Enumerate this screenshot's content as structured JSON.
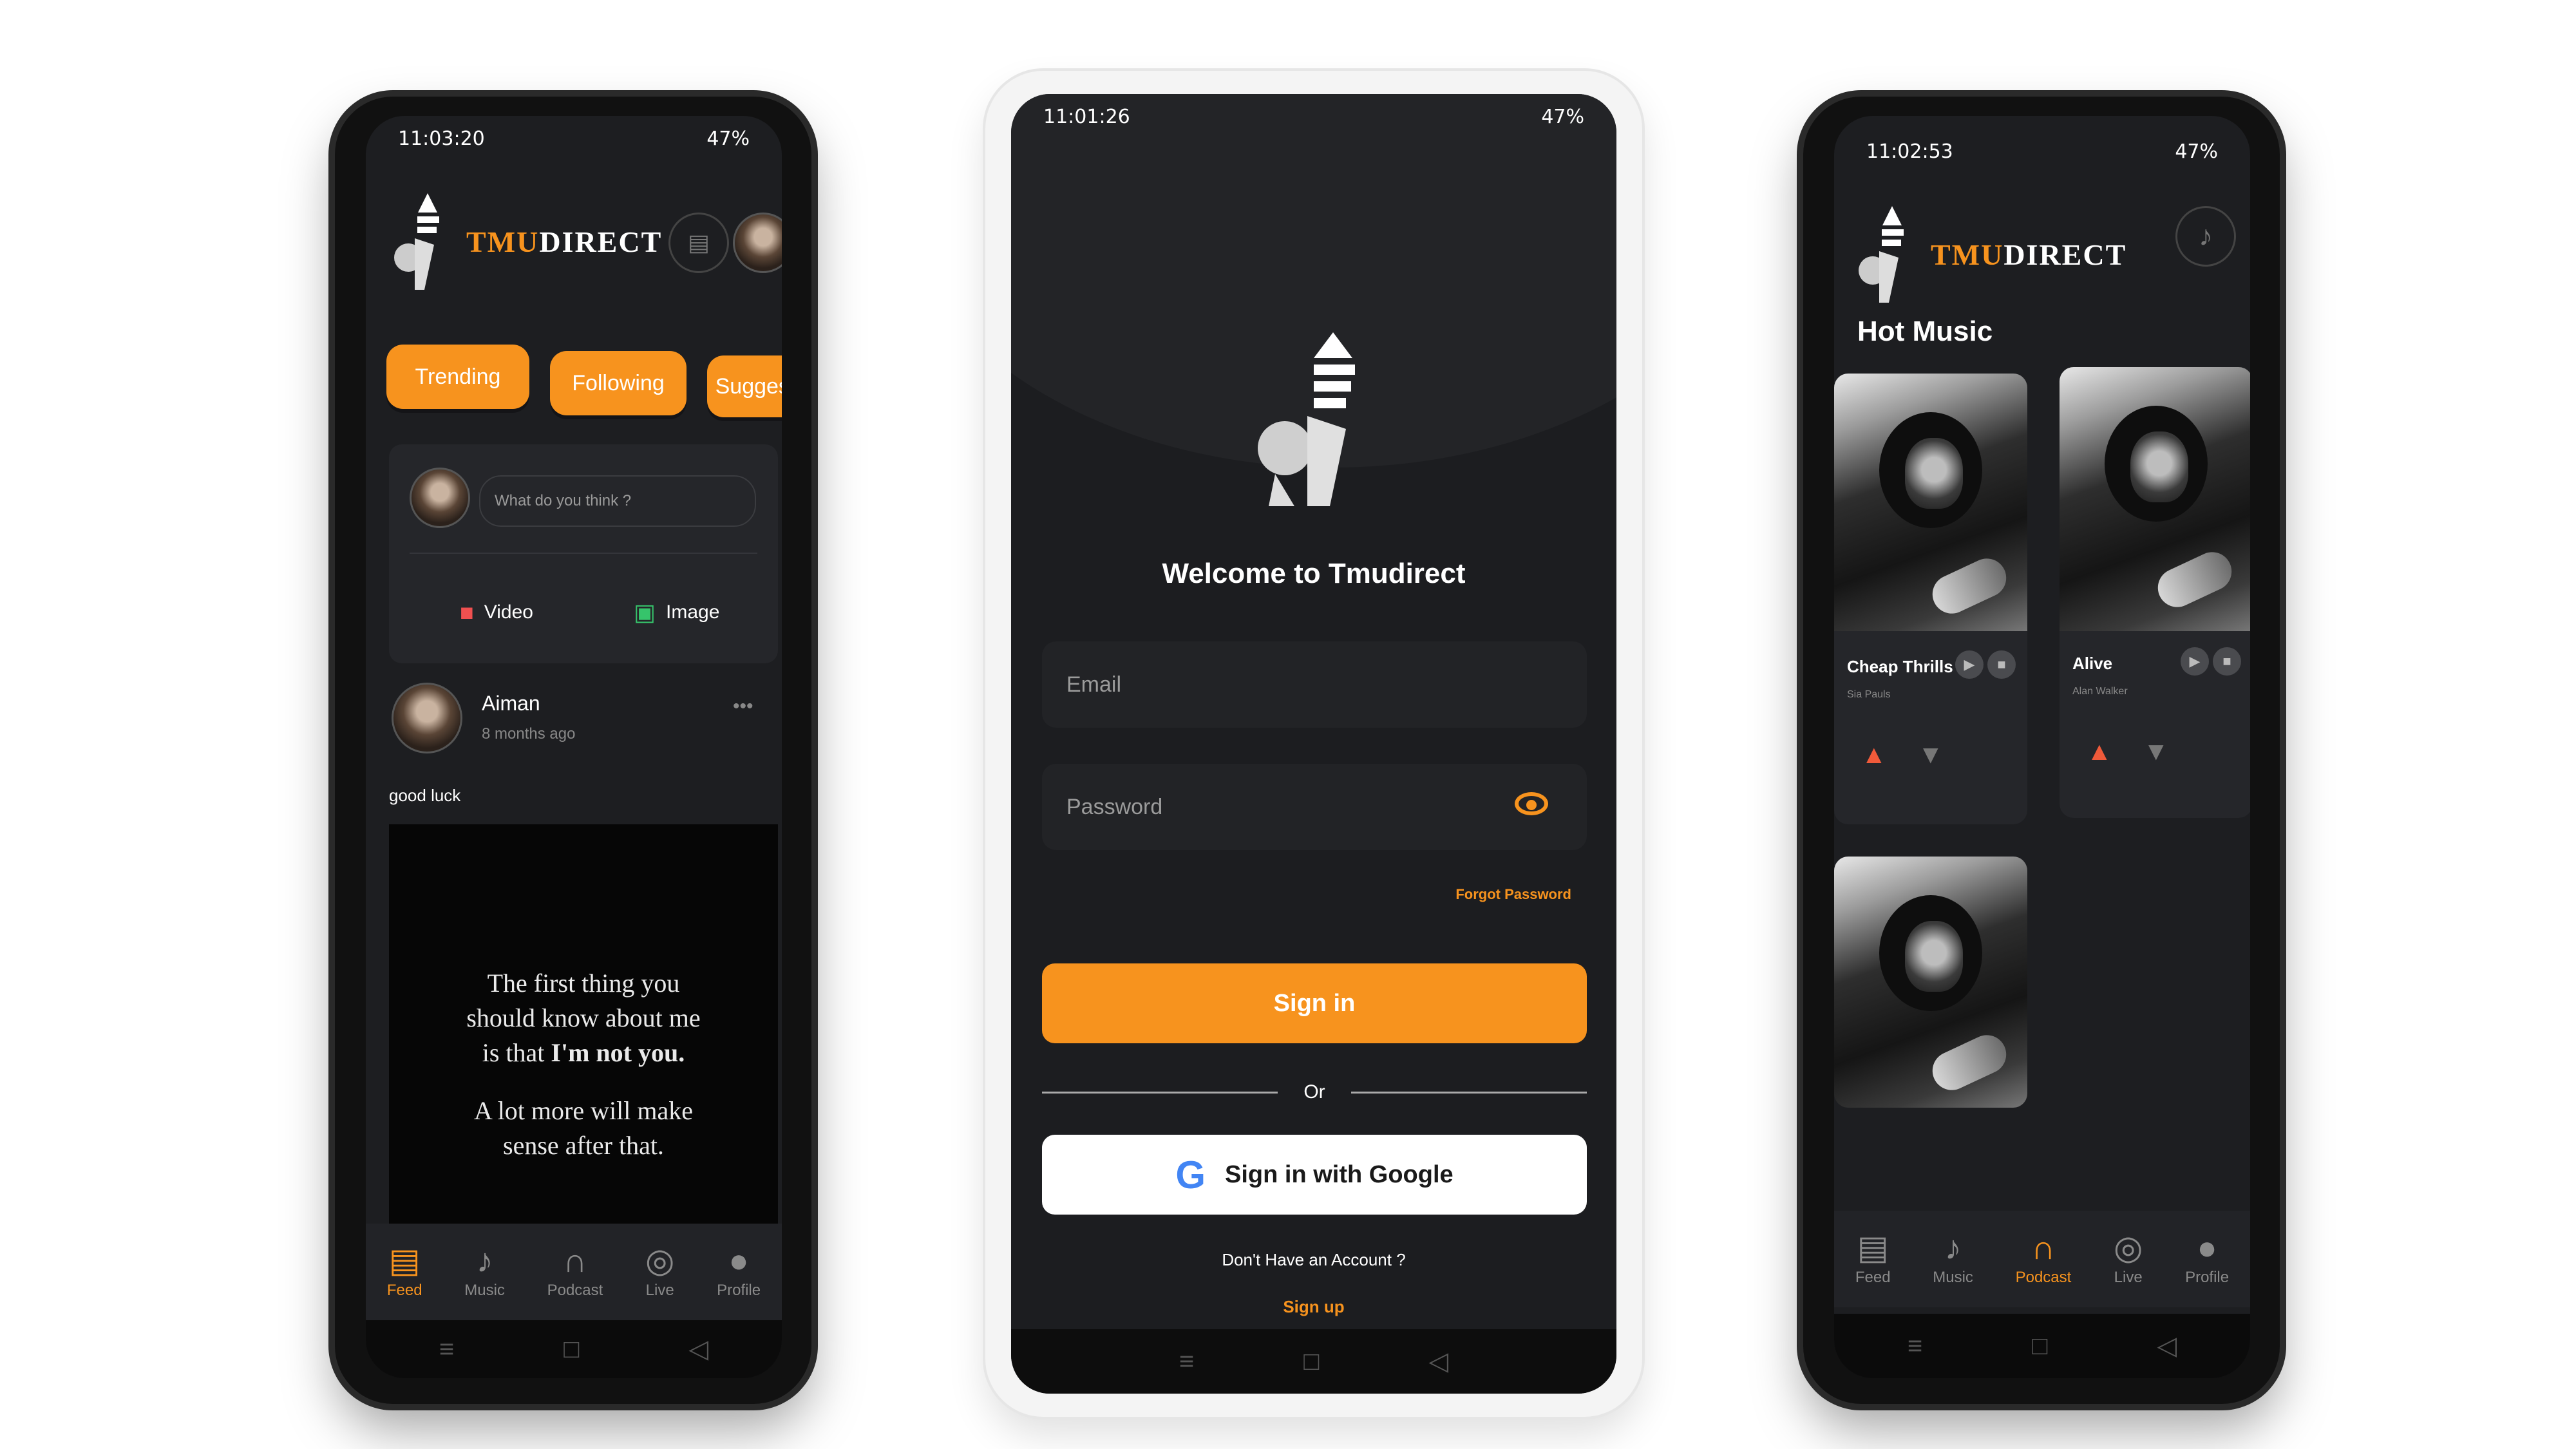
{
  "left_phone": {
    "status_time": "11:03:20",
    "status_right": "47%",
    "brand_orange": "TMU",
    "brand_white": "DIRECT",
    "chips": [
      "Trending",
      "Following",
      "Suggest"
    ],
    "composer_placeholder": "What do you think ?",
    "video_label": "Video",
    "image_label": "Image",
    "post_author": "Aiman",
    "post_time": "8 months ago",
    "post_text": "good luck",
    "quote_line1": "The first thing you",
    "quote_line2": "should know about me",
    "quote_line3a": "is that ",
    "quote_line3b": "I'm not you.",
    "quote_line4": "A lot more will make",
    "quote_line5": "sense after that.",
    "tabs": [
      "Feed",
      "Music",
      "Podcast",
      "Live",
      "Profile"
    ],
    "active_tab": "Feed"
  },
  "center_phone": {
    "status_time": "11:01:26",
    "status_right": "47%",
    "welcome": "Welcome to Tmudirect",
    "email_placeholder": "Email",
    "password_placeholder": "Password",
    "forgot": "Forgot Password",
    "signin": "Sign in",
    "or": "Or",
    "google": "Sign in with Google",
    "no_account": "Don't Have an Account ?",
    "signup": "Sign up"
  },
  "right_phone": {
    "status_time": "11:02:53",
    "status_right": "47%",
    "brand_orange": "TMU",
    "brand_white": "DIRECT",
    "section_title": "Hot Music",
    "songs": [
      {
        "title": "Cheap Thrills",
        "artist": "Sia Pauls"
      },
      {
        "title": "Alive",
        "artist": "Alan Walker"
      }
    ],
    "tabs": [
      "Feed",
      "Music",
      "Podcast",
      "Live",
      "Profile"
    ],
    "active_tab": "Podcast"
  },
  "colors": {
    "accent": "#f7931e",
    "background": "#1d1e21",
    "card": "#25262a"
  }
}
